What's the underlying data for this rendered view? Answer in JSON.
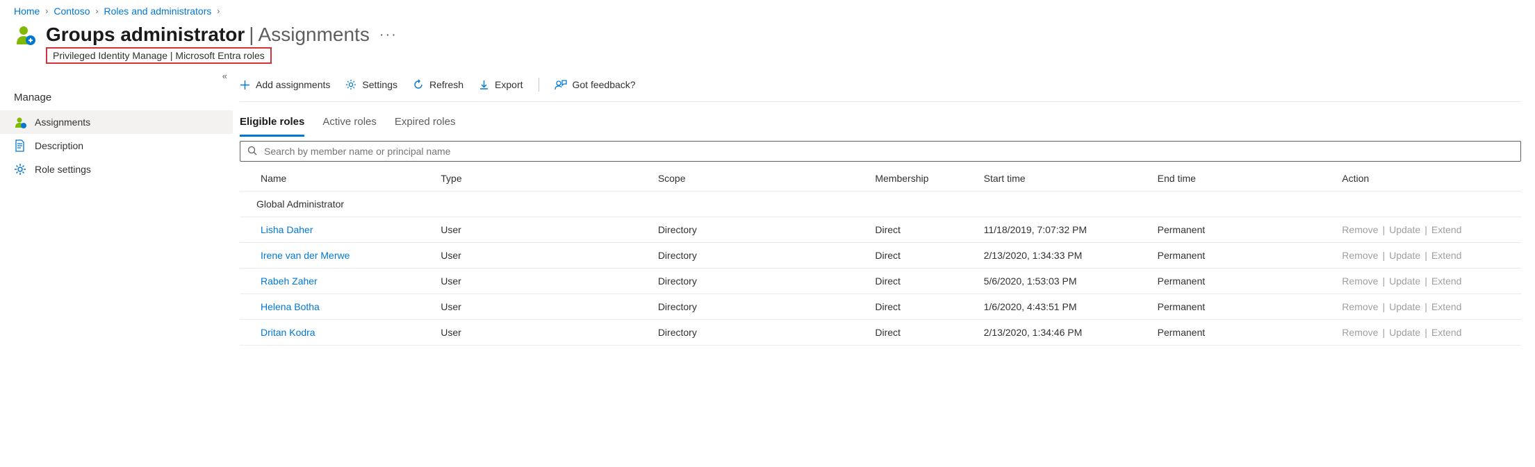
{
  "breadcrumb": [
    "Home",
    "Contoso",
    "Roles and administrators"
  ],
  "title": {
    "role": "Groups administrator",
    "page": "Assignments"
  },
  "subtitle": "Privileged Identity Manage | Microsoft Entra roles",
  "sidebar": {
    "section": "Manage",
    "items": [
      {
        "label": "Assignments"
      },
      {
        "label": "Description"
      },
      {
        "label": "Role settings"
      }
    ]
  },
  "toolbar": {
    "add": "Add assignments",
    "settings": "Settings",
    "refresh": "Refresh",
    "export": "Export",
    "feedback": "Got feedback?"
  },
  "tabs": [
    "Eligible roles",
    "Active roles",
    "Expired roles"
  ],
  "search_placeholder": "Search by member name or principal name",
  "columns": {
    "name": "Name",
    "type": "Type",
    "scope": "Scope",
    "membership": "Membership",
    "start": "Start time",
    "end": "End time",
    "action": "Action"
  },
  "group": "Global Administrator",
  "rows": [
    {
      "name": "Lisha Daher",
      "type": "User",
      "scope": "Directory",
      "membership": "Direct",
      "start": "11/18/2019, 7:07:32 PM",
      "end": "Permanent"
    },
    {
      "name": "Irene van der Merwe",
      "type": "User",
      "scope": "Directory",
      "membership": "Direct",
      "start": "2/13/2020, 1:34:33 PM",
      "end": "Permanent"
    },
    {
      "name": "Rabeh Zaher",
      "type": "User",
      "scope": "Directory",
      "membership": "Direct",
      "start": "5/6/2020, 1:53:03 PM",
      "end": "Permanent"
    },
    {
      "name": "Helena Botha",
      "type": "User",
      "scope": "Directory",
      "membership": "Direct",
      "start": "1/6/2020, 4:43:51 PM",
      "end": "Permanent"
    },
    {
      "name": "Dritan Kodra",
      "type": "User",
      "scope": "Directory",
      "membership": "Direct",
      "start": "2/13/2020, 1:34:46 PM",
      "end": "Permanent"
    }
  ],
  "actions": {
    "remove": "Remove",
    "update": "Update",
    "extend": "Extend"
  }
}
